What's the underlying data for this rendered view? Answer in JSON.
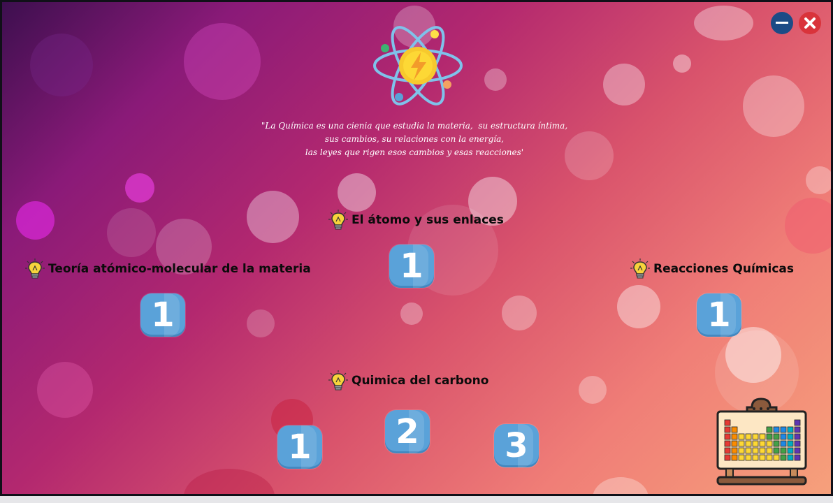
{
  "window": {
    "minimize_icon": "minus-icon",
    "close_icon": "x-icon"
  },
  "header": {
    "logo_icon": "atom-icon",
    "quote_lines": [
      "\"La Química es una cienia que estudia la materia,  su estructura íntima,",
      "sus cambios, su relaciones con la energía,",
      "las leyes que rigen esos cambios y esas reacciones'"
    ]
  },
  "sections": {
    "atomo": {
      "title": "El átomo y sus enlaces",
      "buttons": [
        "1"
      ]
    },
    "teoria": {
      "title": "Teoría atómico-molecular de la materia",
      "buttons": [
        "1"
      ]
    },
    "reacciones": {
      "title": "Reacciones Químicas",
      "buttons": [
        "1"
      ]
    },
    "carbono": {
      "title": "Quimica del carbono",
      "buttons": [
        "1",
        "2",
        "3"
      ]
    }
  },
  "decor": {
    "bulb_icon": "lightbulb-icon",
    "periodic_table_icon": "periodic-table-icon"
  },
  "colors": {
    "button_blue": "#5aa2d9",
    "minimize_blue": "#1c4b86",
    "close_red": "#d9333b"
  }
}
